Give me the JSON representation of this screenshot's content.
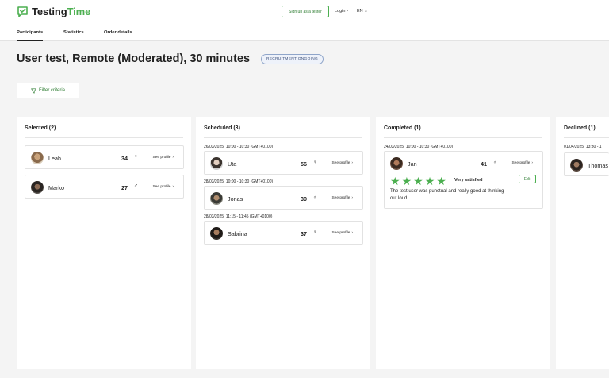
{
  "brand": {
    "name_part1": "Testing",
    "name_part2": "Time",
    "accent_color": "#4caf50"
  },
  "header": {
    "signup_label": "Sign up as a tester",
    "login_label": "Login",
    "lang_label": "EN"
  },
  "tabs": [
    {
      "label": "Participants",
      "active": true
    },
    {
      "label": "Statistics",
      "active": false
    },
    {
      "label": "Order details",
      "active": false
    }
  ],
  "page": {
    "title": "User test, Remote (Moderated), 30 minutes",
    "status_badge": "RECRUITMENT ONGOING",
    "filter_label": "Filter criteria"
  },
  "columns": {
    "selected": {
      "title": "Selected (2)",
      "participants": [
        {
          "name": "Leah",
          "age": "34",
          "gender_icon": "female-icon",
          "gender_symbol": "♀",
          "link": "See profile"
        },
        {
          "name": "Marko",
          "age": "27",
          "gender_icon": "male-icon",
          "gender_symbol": "♂",
          "link": "See profile"
        }
      ]
    },
    "scheduled": {
      "title": "Scheduled (3)",
      "participants": [
        {
          "date": "26/03/2025, 10:00 - 10:30 (GMT+0100)",
          "name": "Uta",
          "age": "56",
          "gender_icon": "female-icon",
          "gender_symbol": "♀",
          "link": "See profile"
        },
        {
          "date": "28/03/2025, 10:00 - 10:30 (GMT+0100)",
          "name": "Jonas",
          "age": "39",
          "gender_icon": "male-icon",
          "gender_symbol": "♂",
          "link": "See profile"
        },
        {
          "date": "28/03/2025, 11:15 - 11:45 (GMT+0100)",
          "name": "Sabrina",
          "age": "37",
          "gender_icon": "female-icon",
          "gender_symbol": "♀",
          "link": "See profile"
        }
      ]
    },
    "completed": {
      "title": "Completed (1)",
      "participants": [
        {
          "date": "24/03/2025, 10:00 - 10:30 (GMT+0100)",
          "name": "Jan",
          "age": "41",
          "gender_icon": "male-icon",
          "gender_symbol": "♂",
          "link": "See profile",
          "rating": 5,
          "rating_text": "Very satisfied",
          "edit_label": "Edit",
          "comment": "The test user was punctual and really good at thinking out loud"
        }
      ]
    },
    "declined": {
      "title": "Declined (1)",
      "participants": [
        {
          "date": "01/04/2025, 13:30 - 1",
          "name": "Thomas"
        }
      ]
    }
  }
}
